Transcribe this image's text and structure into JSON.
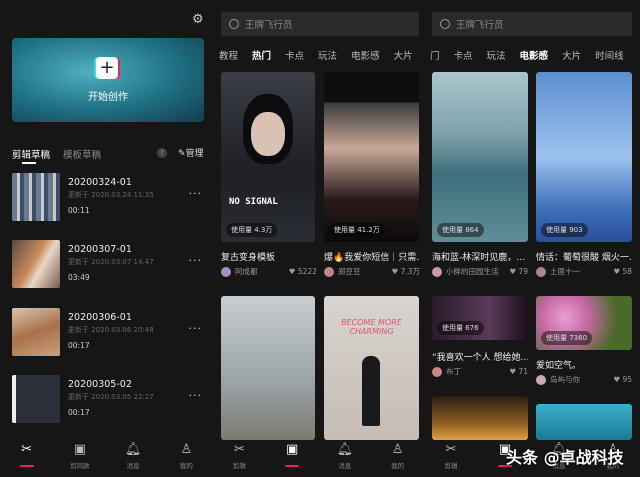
{
  "create": {
    "label": "开始创作"
  },
  "drafts": {
    "tabs": [
      "剪辑草稿",
      "模板草稿"
    ],
    "help": "?",
    "manage": "管理",
    "items": [
      {
        "name": "20200324-01",
        "updated": "更新于 2020.03.24 11:35",
        "duration": "00:11"
      },
      {
        "name": "20200307-01",
        "updated": "更新于 2020.03.07 14:47",
        "duration": "03:49"
      },
      {
        "name": "20200306-01",
        "updated": "更新于 2020.03.06 20:48",
        "duration": "00:17"
      },
      {
        "name": "20200305-02",
        "updated": "更新于 2020.03.05 22:27",
        "duration": "00:17"
      }
    ]
  },
  "search": {
    "placeholder": "王牌飞行员"
  },
  "panel2": {
    "tabs": [
      "教程",
      "热门",
      "卡点",
      "玩法",
      "电影感",
      "大片"
    ],
    "cards": [
      {
        "usage": "使用量 4.3万",
        "title": "复古变身模板",
        "author": "阿成都",
        "likes": "5222",
        "overlay": "NO SIGNAL"
      },
      {
        "usage": "使用量 41.2万",
        "title": "爆🔥我爱你短信｜只需…",
        "author": "郑豆豆",
        "likes": "7.3万"
      },
      {
        "overlay": ""
      },
      {
        "overlay": "BECOME MORE CHARMING"
      }
    ]
  },
  "panel3": {
    "tabs": [
      "门",
      "卡点",
      "玩法",
      "电影感",
      "大片",
      "时间线"
    ],
    "cards": [
      {
        "usage": "使用量 864",
        "title": "海和蓝-林深时见鹿，…",
        "author": "小胖的田园生活",
        "likes": "79"
      },
      {
        "usage": "使用量 903",
        "title": "情话：葡萄很酸 烟火一…",
        "author": "土匪十一",
        "likes": "58"
      },
      {
        "usage": "使用量 676",
        "title": "“我喜欢一个人 想给她…",
        "author": "布丁",
        "likes": "71"
      },
      {
        "usage": "使用量 7360",
        "title": "爱如空气。",
        "author": "岛屿与你",
        "likes": "95"
      }
    ]
  },
  "nav": {
    "p1": [
      "",
      "剪同款",
      "消息",
      "我的"
    ],
    "p2": [
      "剪辑",
      "",
      "消息",
      "我的"
    ],
    "p3": [
      "剪辑",
      "",
      "消息",
      "我的"
    ]
  },
  "watermark": "头条 @卓战科技",
  "colors": {
    "accent": "#e6245b",
    "bg": "#161616"
  }
}
